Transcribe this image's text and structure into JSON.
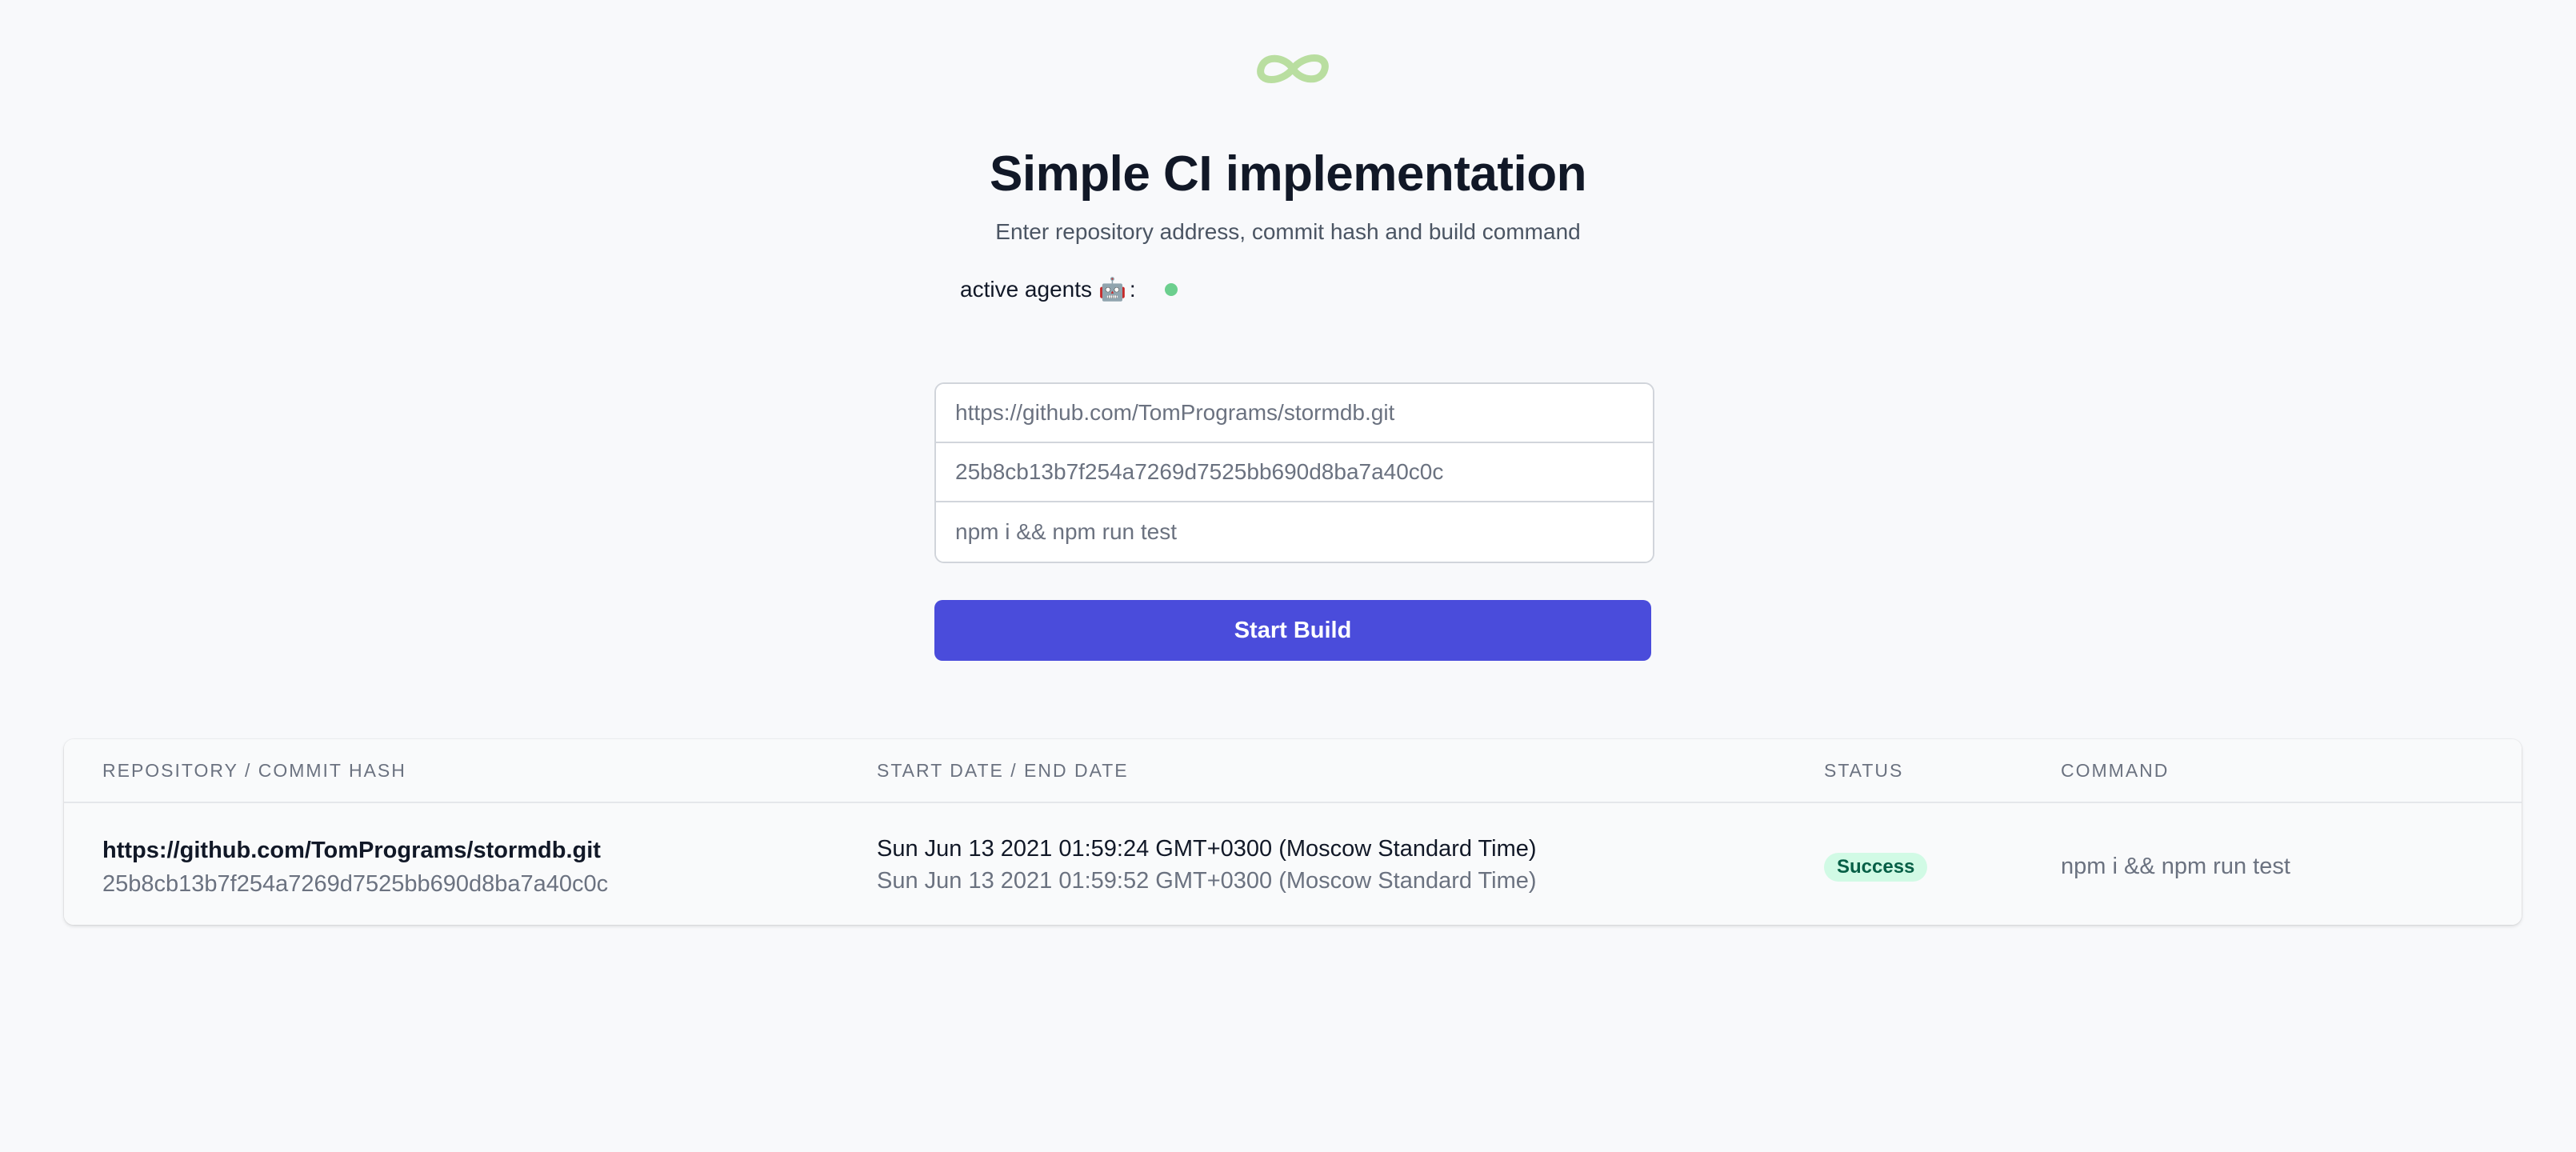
{
  "header": {
    "logo_icon": "infinity-icon",
    "logo_color": "#b9dea0",
    "title": "Simple CI implementation",
    "subtitle": "Enter repository address, commit hash and build command",
    "agents_label": "active agents",
    "agents_emoji": "🤖",
    "agents_separator": ":",
    "agent_status_color": "#6ccf8e"
  },
  "form": {
    "repository_placeholder": "https://github.com/TomPrograms/stormdb.git",
    "commit_placeholder": "25b8cb13b7f254a7269d7525bb690d8ba7a40c0c",
    "command_placeholder": "npm i && npm run test",
    "submit_label": "Start Build",
    "submit_color": "#4a4cdb"
  },
  "builds_table": {
    "columns": [
      "Repository / Commit hash",
      "Start date / End date",
      "Status",
      "Command"
    ],
    "rows": [
      {
        "repository": "https://github.com/TomPrograms/stormdb.git",
        "commit_hash": "25b8cb13b7f254a7269d7525bb690d8ba7a40c0c",
        "start_date": "Sun Jun 13 2021 01:59:24 GMT+0300 (Moscow Standard Time)",
        "end_date": "Sun Jun 13 2021 01:59:52 GMT+0300 (Moscow Standard Time)",
        "status": "Success",
        "status_color": "#d1fae5",
        "command": "npm i && npm run test"
      }
    ]
  }
}
